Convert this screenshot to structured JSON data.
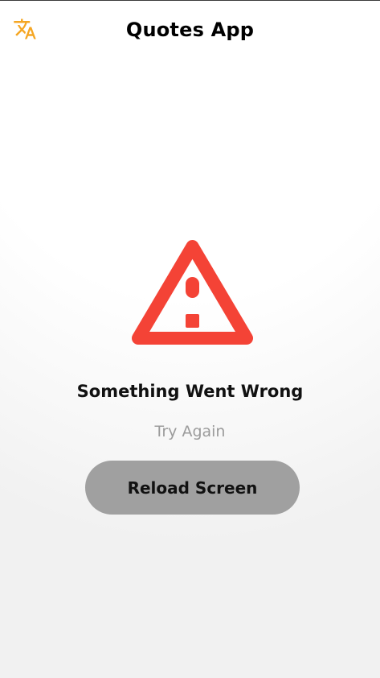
{
  "app_bar": {
    "title": "Quotes App",
    "translate_icon": "translate-icon",
    "accent_color": "#F5A623"
  },
  "error": {
    "icon": "warning-icon",
    "icon_color": "#F44336",
    "title": "Something Went Wrong",
    "subtitle": "Try Again",
    "reload_label": "Reload Screen"
  }
}
